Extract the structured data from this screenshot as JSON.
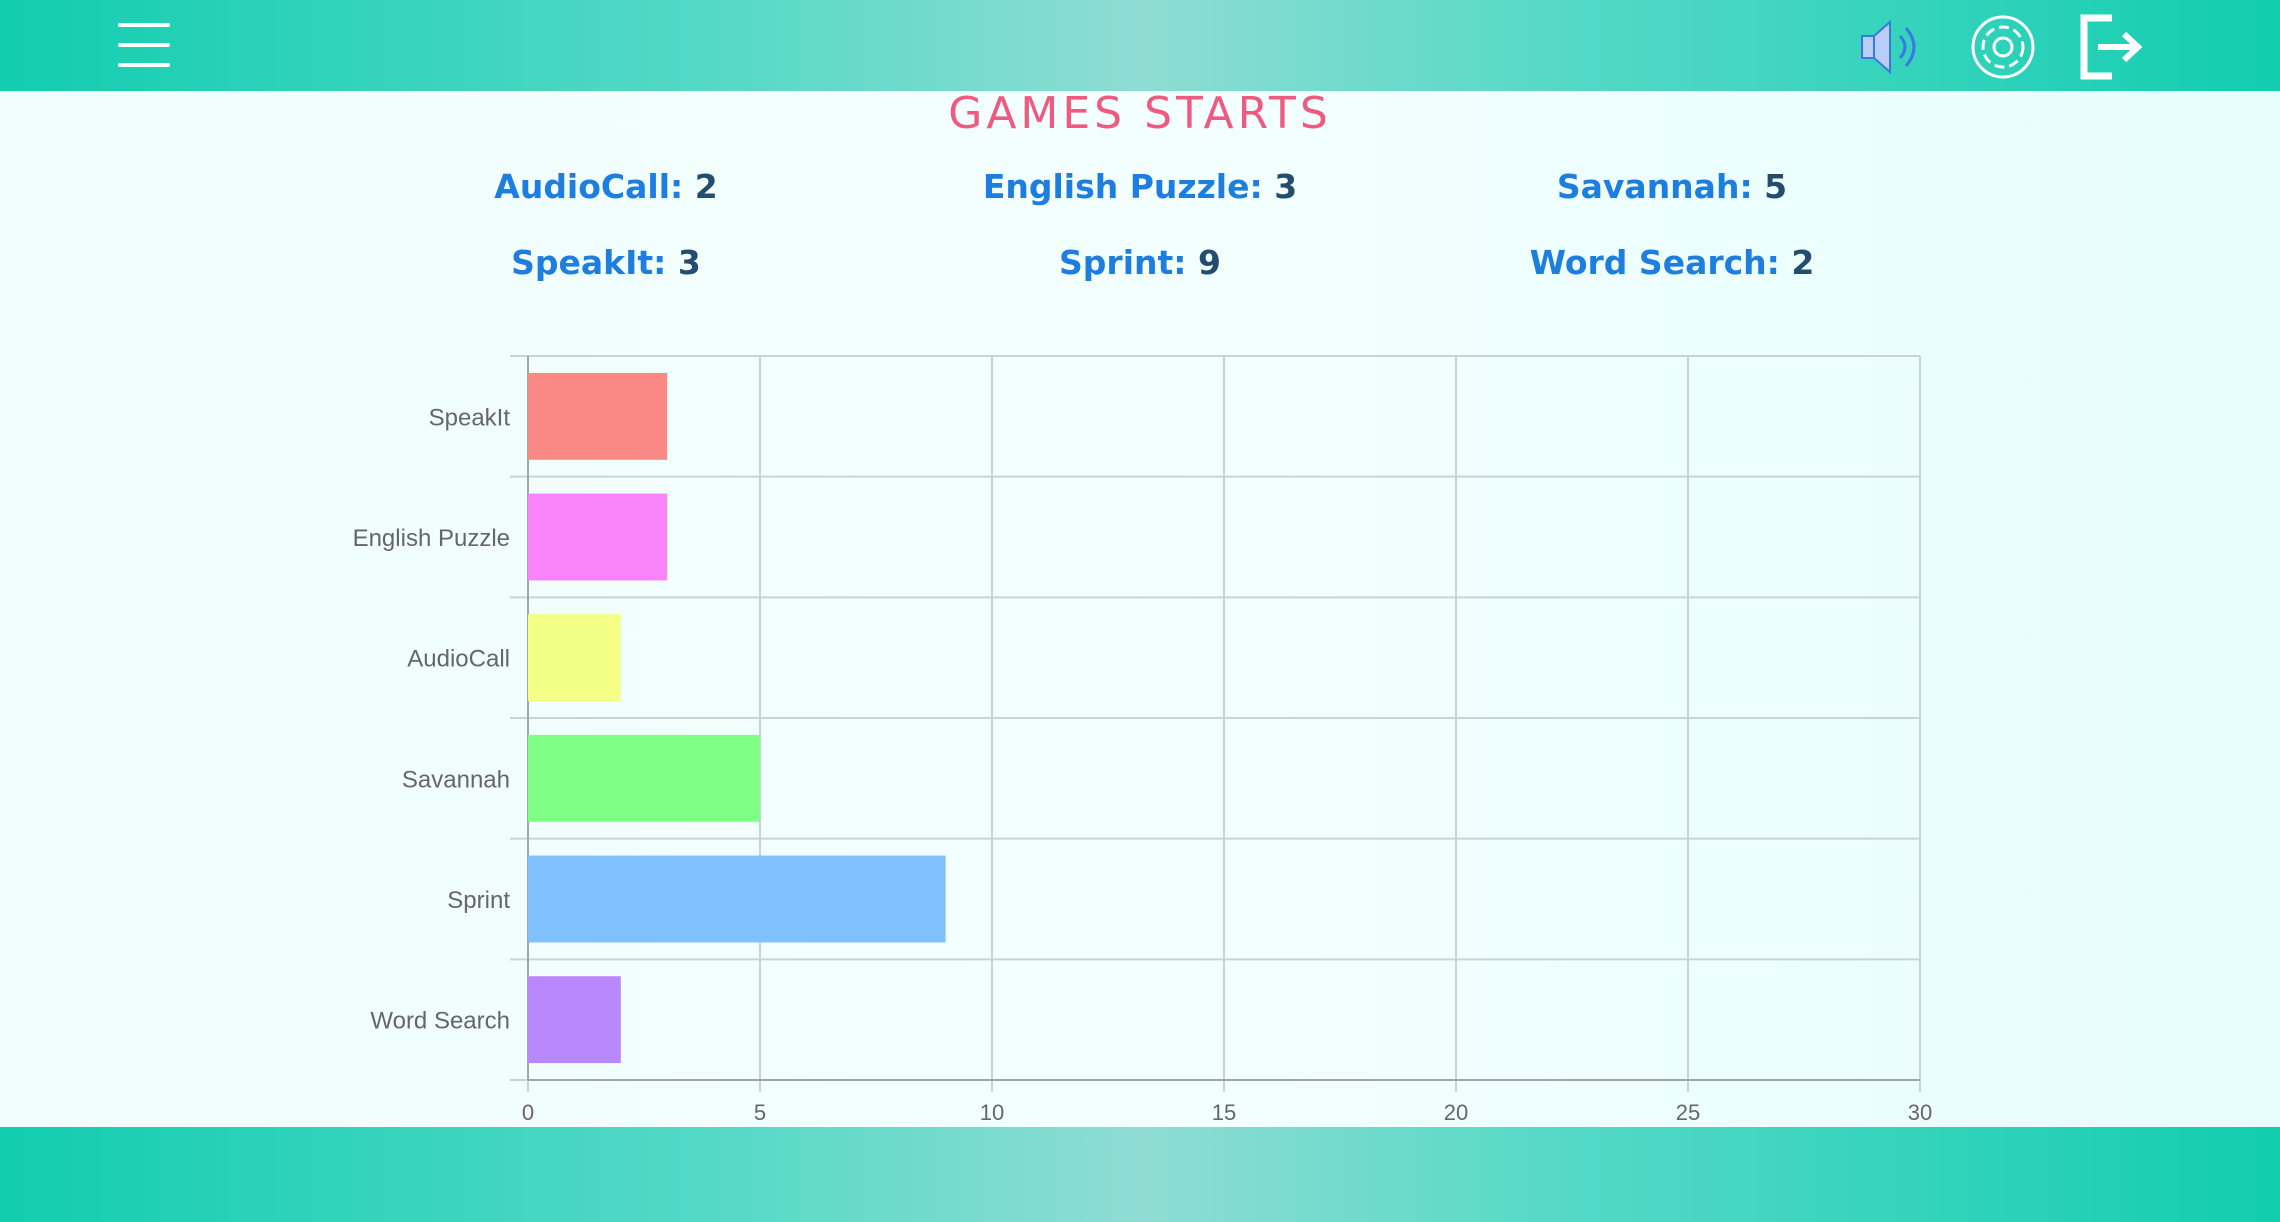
{
  "header": {
    "menu_icon": "hamburger-menu-icon",
    "sound_icon": "speaker-icon",
    "settings_icon": "gear-icon",
    "logout_icon": "logout-icon"
  },
  "title": "GAMES STARTS",
  "stats": [
    {
      "name": "AudioCall:",
      "value": "2"
    },
    {
      "name": "English Puzzle:",
      "value": "3"
    },
    {
      "name": "Savannah:",
      "value": "5"
    },
    {
      "name": "SpeakIt:",
      "value": "3"
    },
    {
      "name": "Sprint:",
      "value": "9"
    },
    {
      "name": "Word Search:",
      "value": "2"
    }
  ],
  "colors": {
    "header": "#12cdb0",
    "title": "#ee5a80",
    "stat_name": "#1e7ee0",
    "stat_value": "#234d6e"
  },
  "chart_data": {
    "type": "bar",
    "orientation": "horizontal",
    "categories": [
      "SpeakIt",
      "English Puzzle",
      "AudioCall",
      "Savannah",
      "Sprint",
      "Word Search"
    ],
    "values": [
      3,
      3,
      2,
      5,
      9,
      2
    ],
    "colors": [
      "#fa8884",
      "#f784f9",
      "#f3ff85",
      "#7fff85",
      "#80c0ff",
      "#b988fc"
    ],
    "xlim": [
      0,
      30
    ],
    "xticks": [
      "0",
      "5",
      "10",
      "15",
      "20",
      "25",
      "30"
    ],
    "grid": true,
    "legend": "none"
  }
}
